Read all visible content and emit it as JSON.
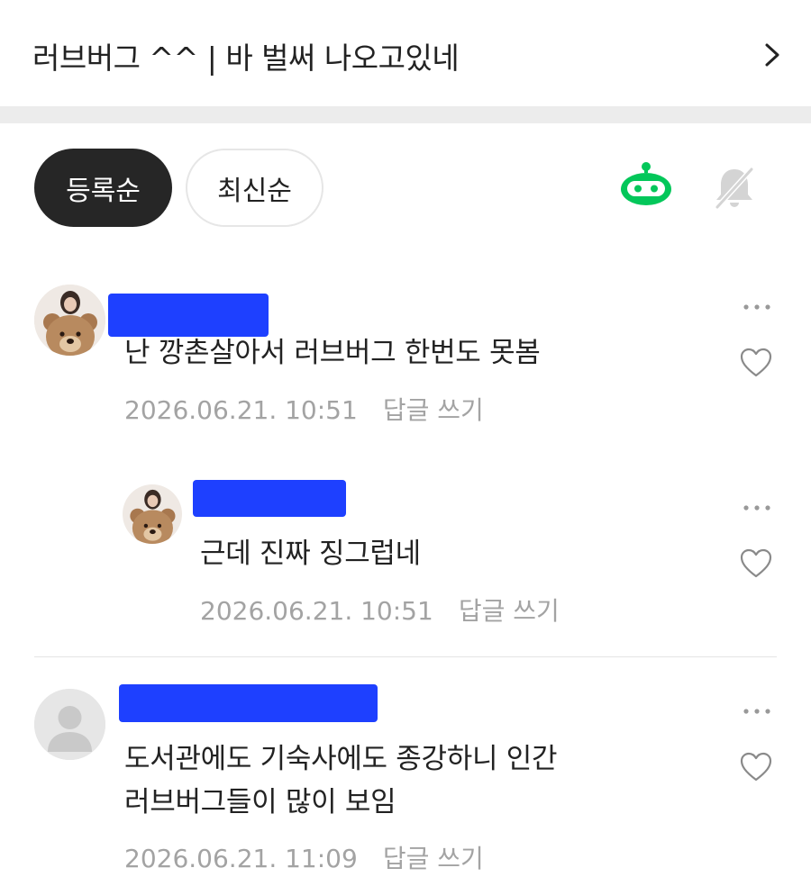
{
  "header": {
    "title": "러브버그 ^^ | 바 벌써 나오고있네"
  },
  "sort": {
    "registered": "등록순",
    "latest": "최신순"
  },
  "icons": {
    "chevron": "chevron-right-icon",
    "bot": "bot-icon",
    "bell": "bell-off-icon",
    "more": "more-horizontal-icon",
    "heart": "heart-outline-icon"
  },
  "colors": {
    "accent_green": "#03c75a",
    "active_pill": "#262626",
    "redaction": "#1e40ff",
    "meta_gray": "#a3a3a3"
  },
  "comments": [
    {
      "text": "난 깡촌살아서 러브버그 한번도 못봄",
      "date": "2026.06.21. 10:51",
      "reply_label": "답글 쓰기"
    },
    {
      "text": "근데 진짜 징그럽네",
      "date": "2026.06.21. 10:51",
      "reply_label": "답글 쓰기"
    },
    {
      "text_line1": "도서관에도 기숙사에도 종강하니 인간",
      "text_line2": "러브버그들이 많이 보임",
      "date": "2026.06.21. 11:09",
      "reply_label": "답글 쓰기"
    }
  ]
}
